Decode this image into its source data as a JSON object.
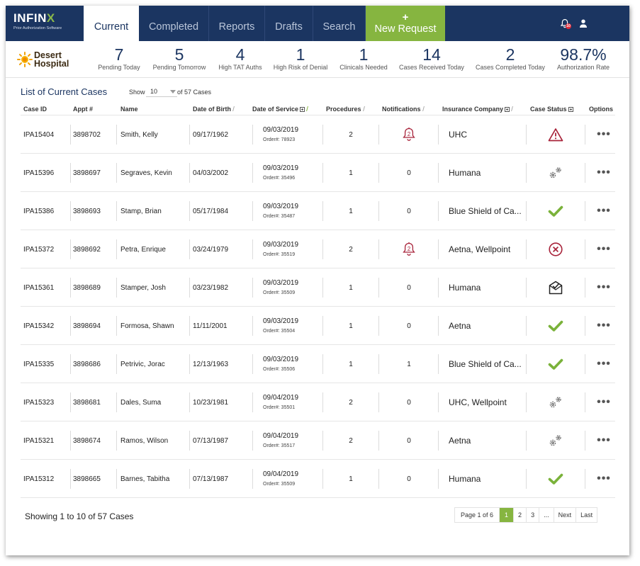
{
  "brand": {
    "name_main": "INFIN",
    "name_x": "X",
    "subtitle": "Prior Authorization Software"
  },
  "nav": {
    "tabs": [
      {
        "label": "Current"
      },
      {
        "label": "Completed"
      },
      {
        "label": "Reports"
      },
      {
        "label": "Drafts"
      },
      {
        "label": "Search"
      }
    ],
    "new_request": {
      "plus": "+",
      "label": "New Request"
    },
    "notification_badge": "10"
  },
  "hospital": {
    "line1": "Desert",
    "line2": "Hospital"
  },
  "stats": [
    {
      "value": "7",
      "label": "Pending Today"
    },
    {
      "value": "5",
      "label": "Pending Tomorrow"
    },
    {
      "value": "4",
      "label": "High TAT Auths"
    },
    {
      "value": "1",
      "label": "High Risk of Denial"
    },
    {
      "value": "1",
      "label": "Clinicals Needed"
    },
    {
      "value": "14",
      "label": "Cases Received Today"
    },
    {
      "value": "2",
      "label": "Cases Completed Today"
    },
    {
      "value": "98.7%",
      "label": "Authorization Rate"
    }
  ],
  "list": {
    "title": "List of Current Cases",
    "show_label": "Show",
    "show_value": "10",
    "of_label": "of 57 Cases"
  },
  "columns": [
    "Case ID",
    "Appt #",
    "Name",
    "Date of Birth",
    "Date of Service",
    "Procedures",
    "Notifications",
    "Insurance Company",
    "Case Status",
    "Options"
  ],
  "rows": [
    {
      "case_id": "IPA15404",
      "appt": "3898702",
      "name": "Smith, Kelly",
      "dob": "09/17/1962",
      "dos": "09/03/2019",
      "order": "Order#: 78923",
      "procedures": "2",
      "notifications": "2",
      "notif_type": "bell",
      "insurance": "UHC",
      "status": "warning-icon",
      "options": "•••"
    },
    {
      "case_id": "IPA15396",
      "appt": "3898697",
      "name": "Segraves, Kevin",
      "dob": "04/03/2002",
      "dos": "09/03/2019",
      "order": "Order#: 35496",
      "procedures": "1",
      "notifications": "0",
      "notif_type": "text",
      "insurance": "Humana",
      "status": "gears-icon",
      "options": "•••"
    },
    {
      "case_id": "IPA15386",
      "appt": "3898693",
      "name": "Stamp, Brian",
      "dob": "05/17/1984",
      "dos": "09/03/2019",
      "order": "Order#: 35487",
      "procedures": "1",
      "notifications": "0",
      "notif_type": "text",
      "insurance": "Blue Shield of Ca...",
      "status": "check-icon",
      "options": "•••"
    },
    {
      "case_id": "IPA15372",
      "appt": "3898692",
      "name": "Petra, Enrique",
      "dob": "03/24/1979",
      "dos": "09/03/2019",
      "order": "Order#: 35519",
      "procedures": "2",
      "notifications": "2",
      "notif_type": "bell",
      "insurance": "Aetna, Wellpoint",
      "status": "denied-icon",
      "options": "•••"
    },
    {
      "case_id": "IPA15361",
      "appt": "3898689",
      "name": "Stamper, Josh",
      "dob": "03/23/1982",
      "dos": "09/03/2019",
      "order": "Order#: 35509",
      "procedures": "1",
      "notifications": "0",
      "notif_type": "text",
      "insurance": "Humana",
      "status": "mail-check-icon",
      "options": "•••"
    },
    {
      "case_id": "IPA15342",
      "appt": "3898694",
      "name": "Formosa, Shawn",
      "dob": "11/11/2001",
      "dos": "09/03/2019",
      "order": "Order#: 35504",
      "procedures": "1",
      "notifications": "0",
      "notif_type": "text",
      "insurance": "Aetna",
      "status": "check-icon",
      "options": "•••"
    },
    {
      "case_id": "IPA15335",
      "appt": "3898686",
      "name": "Petrivic, Jorac",
      "dob": "12/13/1963",
      "dos": "09/03/2019",
      "order": "Order#: 35506",
      "procedures": "1",
      "notifications": "1",
      "notif_type": "text",
      "insurance": "Blue Shield of Ca...",
      "status": "check-icon",
      "options": "•••"
    },
    {
      "case_id": "IPA15323",
      "appt": "3898681",
      "name": "Dales, Suma",
      "dob": "10/23/1981",
      "dos": "09/04/2019",
      "order": "Order#: 35501",
      "procedures": "2",
      "notifications": "0",
      "notif_type": "text",
      "insurance": "UHC, Wellpoint",
      "status": "gears-icon",
      "options": "•••"
    },
    {
      "case_id": "IPA15321",
      "appt": "3898674",
      "name": "Ramos, Wilson",
      "dob": "07/13/1987",
      "dos": "09/04/2019",
      "order": "Order#: 35517",
      "procedures": "2",
      "notifications": "0",
      "notif_type": "text",
      "insurance": "Aetna",
      "status": "gears-icon",
      "options": "•••"
    },
    {
      "case_id": "IPA15312",
      "appt": "3898665",
      "name": "Barnes, Tabitha",
      "dob": "07/13/1987",
      "dos": "09/04/2019",
      "order": "Order#: 35509",
      "procedures": "1",
      "notifications": "0",
      "notif_type": "text",
      "insurance": "Humana",
      "status": "check-icon",
      "options": "•••"
    }
  ],
  "footer": {
    "showing": "Showing 1 to 10 of 57 Cases",
    "page_info": "Page 1 of 6",
    "pages": [
      "1",
      "2",
      "3",
      "..."
    ],
    "next": "Next",
    "last": "Last"
  },
  "colors": {
    "navy": "#1b3561",
    "green": "#86b540",
    "alert_red": "#a8233a",
    "badge_red": "#e02b3a"
  }
}
